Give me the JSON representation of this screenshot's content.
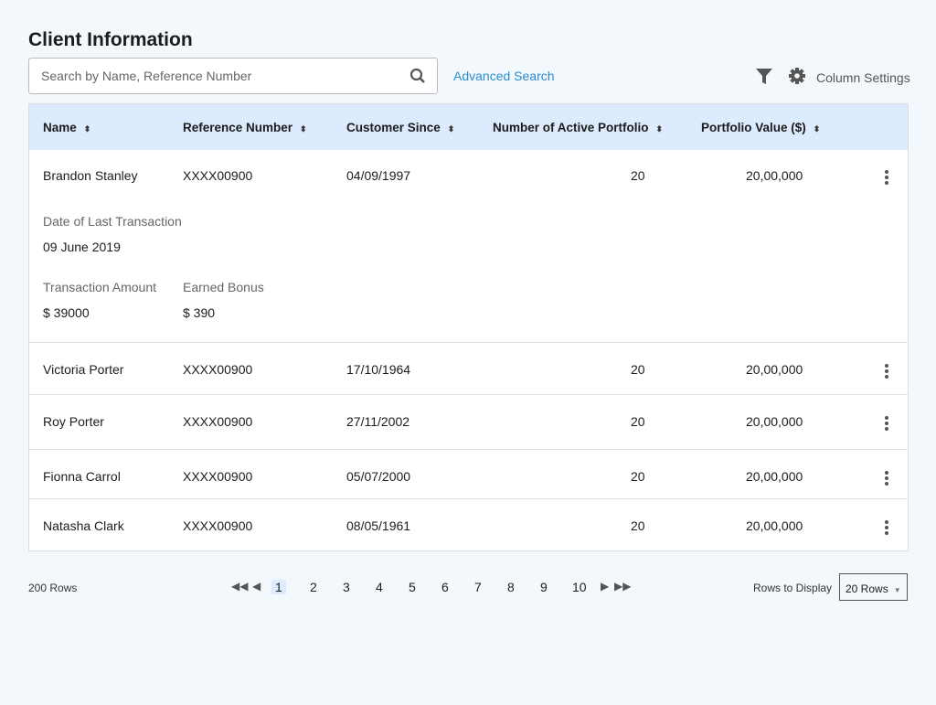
{
  "title": "Client Information",
  "search": {
    "placeholder": "Search by Name, Reference Number",
    "value": ""
  },
  "toolbar": {
    "advanced_search": "Advanced Search",
    "column_settings": "Column Settings"
  },
  "columns": [
    "Name",
    "Reference Number",
    "Customer Since",
    "Number of Active Portfolio",
    "Portfolio Value ($)"
  ],
  "rows": [
    {
      "name": "Brandon Stanley",
      "ref": "XXXX00900",
      "since": "04/09/1997",
      "portfolios": "20",
      "value": "20,00,000",
      "expanded": {
        "last_txn_label": "Date of Last Transaction",
        "last_txn": "09 June 2019",
        "amount_label": "Transaction Amount",
        "amount": "$ 39000",
        "bonus_label": "Earned Bonus",
        "bonus": "$ 390"
      }
    },
    {
      "name": "Victoria Porter",
      "ref": "XXXX00900",
      "since": "17/10/1964",
      "portfolios": "20",
      "value": "20,00,000"
    },
    {
      "name": "Roy Porter",
      "ref": "XXXX00900",
      "since": "27/11/2002",
      "portfolios": "20",
      "value": "20,00,000"
    },
    {
      "name": "Fionna Carrol",
      "ref": "XXXX00900",
      "since": "05/07/2000",
      "portfolios": "20",
      "value": "20,00,000"
    },
    {
      "name": "Natasha Clark",
      "ref": "XXXX00900",
      "since": "08/05/1961",
      "portfolios": "20",
      "value": "20,00,000"
    }
  ],
  "footer": {
    "total": "200 Rows",
    "pages": [
      "1",
      "2",
      "3",
      "4",
      "5",
      "6",
      "7",
      "8",
      "9",
      "10"
    ],
    "current_page": "1",
    "rows_label": "Rows to Display",
    "rows_value": "20 Rows"
  },
  "colors": {
    "accent": "#2a8ccf",
    "header_bg": "#dcebfd",
    "page_bg": "#f3f8fd"
  }
}
